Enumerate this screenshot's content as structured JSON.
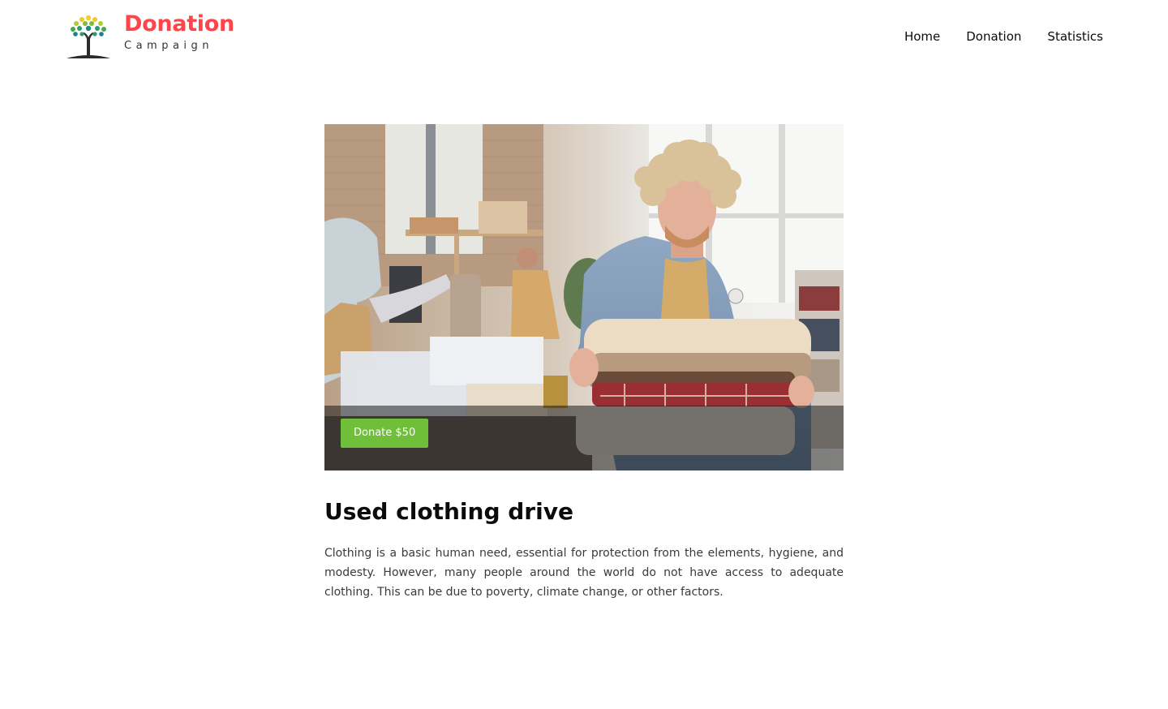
{
  "header": {
    "logo": {
      "title": "Donation",
      "subtitle": "Campaign",
      "icon": "tree-logo-icon"
    },
    "nav": [
      {
        "label": "Home"
      },
      {
        "label": "Donation"
      },
      {
        "label": "Statistics"
      }
    ]
  },
  "campaign": {
    "image_alt": "Man holding a stack of folded used clothes at a donation center",
    "donate_button": "Donate $50",
    "button_color": "#6fbf3a",
    "title": "Used clothing drive",
    "description": "Clothing is a basic human need, essential for protection from the elements, hygiene, and modesty. However, many people around the world do not have access to adequate clothing. This can be due to poverty, climate change, or other factors."
  },
  "colors": {
    "brand": "#ff444a",
    "accent": "#6fbf3a",
    "text": "#0b0b0b"
  }
}
